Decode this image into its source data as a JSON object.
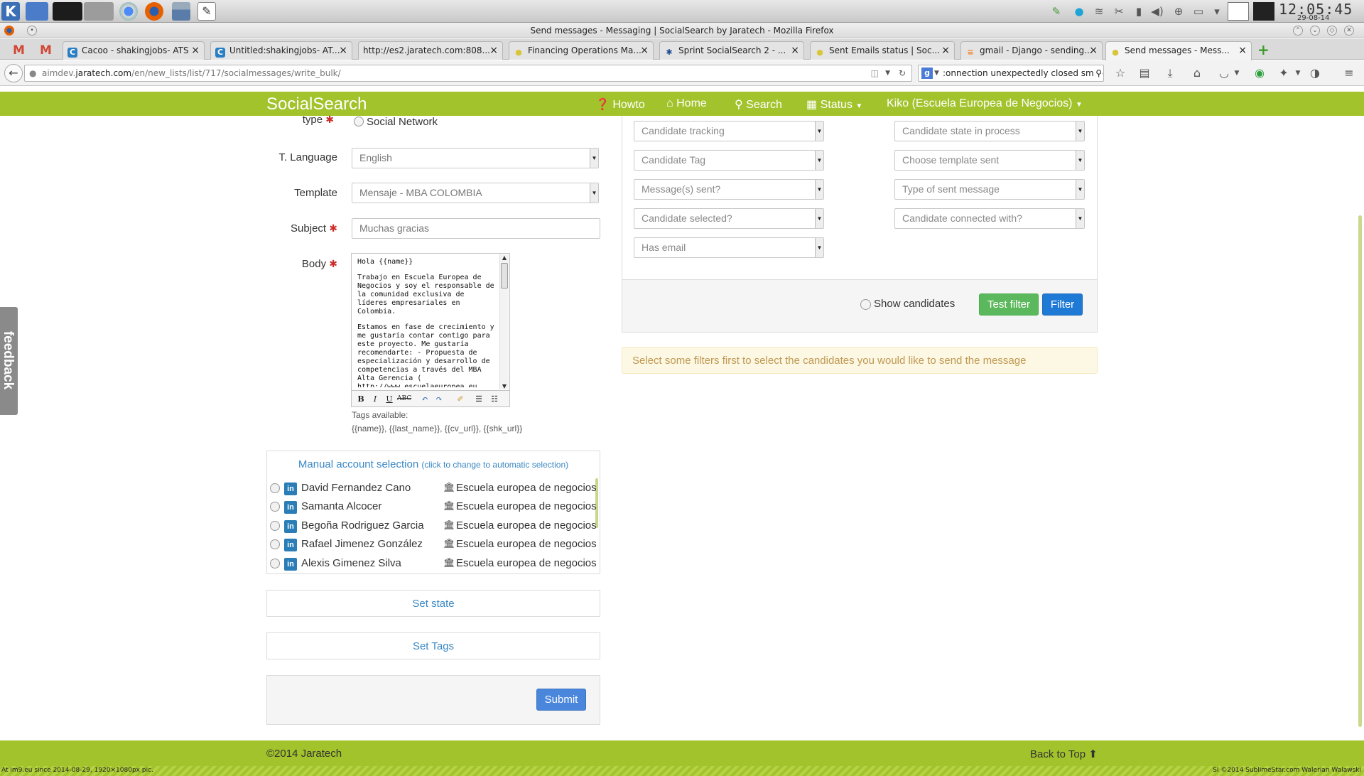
{
  "desktop": {
    "clock_time": "12:05:45",
    "clock_date": "29-08-14"
  },
  "window": {
    "title": "Send messages - Messaging | SocialSearch by Jaratech - Mozilla Firefox"
  },
  "tabs": [
    {
      "label": "Cacoo - shakingjobs- ATS"
    },
    {
      "label": "Untitled:shakingjobs- AT..."
    },
    {
      "label": "http://es2.jaratech.com:808..."
    },
    {
      "label": "Financing Operations Ma..."
    },
    {
      "label": "Sprint SocialSearch 2 - ..."
    },
    {
      "label": "Sent Emails status | Soc..."
    },
    {
      "label": "gmail - Django - sending..."
    },
    {
      "label": "Send messages - Mess..."
    }
  ],
  "browser": {
    "url_prefix": "aimdev.",
    "url_host": "jaratech.com",
    "url_path": "/en/new_lists/list/717/socialmessages/write_bulk/",
    "search_value": ":onnection unexpectedly closed smtp"
  },
  "app": {
    "brand": "SocialSearch",
    "nav": {
      "howto": "Howto",
      "home": "Home",
      "search": "Search",
      "status": "Status",
      "user": "Kiko (Escuela Europea de Negocios)"
    }
  },
  "form": {
    "type_label": "type",
    "type_option": "Social Network",
    "language_label": "T. Language",
    "language_value": "English",
    "template_label": "Template",
    "template_value": "Mensaje - MBA COLOMBIA",
    "subject_label": "Subject",
    "subject_value": "Muchas gracias",
    "body_label": "Body",
    "body_paragraphs": [
      "Hola {{name}}",
      "Trabajo en Escuela Europea de Negocios y soy el responsable de la comunidad exclusiva de líderes empresariales en Colombia.",
      "Estamos en fase de crecimiento y me gustaría contar contigo para este proyecto. Me gustaría recomendarte: - Propuesta de especialización y desarrollo de competencias a través del MBA Alta Gerencia ( http://www.escuelaeuropea.eu /es/bogota/mba-alta-gerencia )"
    ],
    "tags_title": "Tags available:",
    "tags_list": "{{name}}, {{last_name}}, {{cv_url}}, {{shk_url}}"
  },
  "accounts": {
    "title": "Manual account selection",
    "hint": "(click to change to automatic selection)",
    "rows": [
      {
        "name": "David Fernandez Cano",
        "institution": "Escuela europea de negocios"
      },
      {
        "name": "Samanta Alcocer",
        "institution": "Escuela europea de negocios"
      },
      {
        "name": "Begoña Rodriguez Garcia",
        "institution": "Escuela europea de negocios"
      },
      {
        "name": "Rafael Jimenez González",
        "institution": "Escuela europea de negocios"
      },
      {
        "name": "Alexis Gimenez Silva",
        "institution": "Escuela europea de negocios"
      }
    ]
  },
  "actions": {
    "set_state": "Set state",
    "set_tags": "Set Tags",
    "submit": "Submit"
  },
  "filters": {
    "candidate_tracking": "Candidate tracking",
    "candidate_state": "Candidate state in process",
    "candidate_tag": "Candidate Tag",
    "template_sent": "Choose template sent",
    "messages_sent": "Message(s) sent?",
    "sent_message_type": "Type of sent message",
    "candidate_selected": "Candidate selected?",
    "candidate_connected": "Candidate connected with?",
    "has_email": "Has email",
    "show_candidates": "Show candidates",
    "test_filter": "Test filter",
    "filter": "Filter",
    "warning": "Select some filters first to select the candidates you would like to send the message"
  },
  "feedback_tab": "feedback",
  "footer": {
    "copyright": "©2014 Jaratech",
    "back_to_top": "Back to Top"
  },
  "status_strip": {
    "left": "At im9.eu since 2014-08-29, 1920×1080px pic.",
    "right": "SI ©2014 SublimeStar.com Walerian Walawski"
  },
  "colors": {
    "brand_green": "#a2c32b",
    "link_blue": "#3a88c5",
    "btn_green": "#5cb85c",
    "btn_blue": "#1f7ad6",
    "warning_bg": "#fcf8e3",
    "warning_text": "#c09853"
  }
}
